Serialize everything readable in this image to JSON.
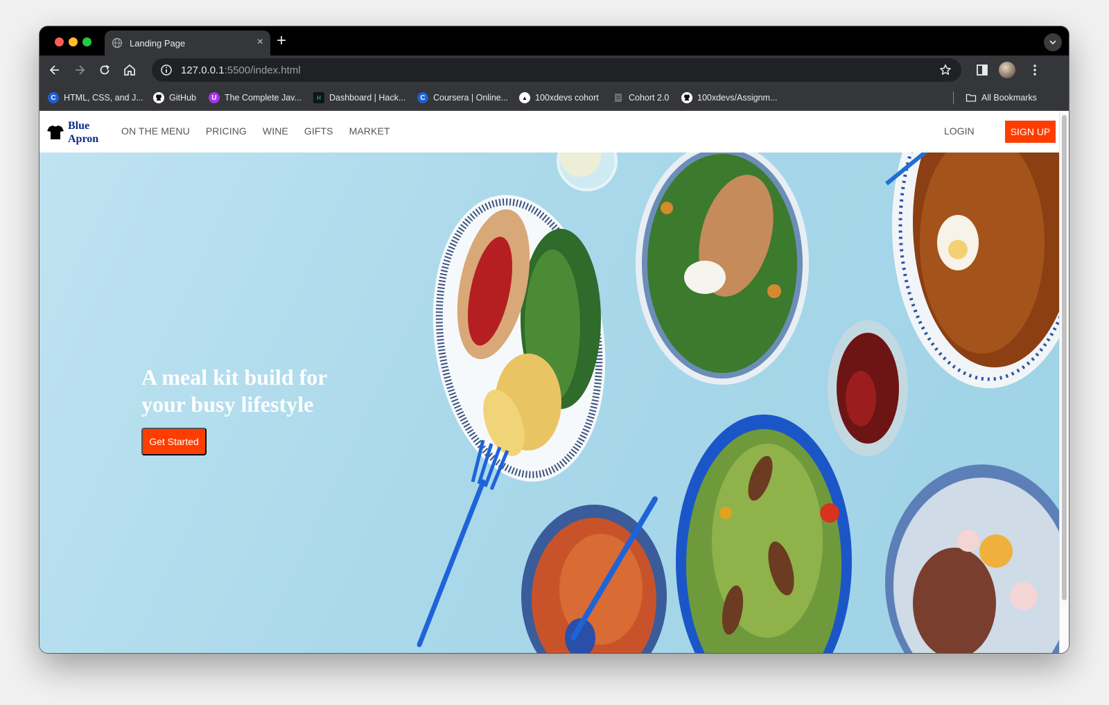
{
  "browser": {
    "tab_title": "Landing Page",
    "tab_close": "×",
    "new_tab": "+",
    "url_host": "127.0.0.1",
    "url_path": ":5500/index.html",
    "bookmarks": [
      {
        "label": "HTML, CSS, and J...",
        "icon": "coursera-icon",
        "color": "#1f5fd1",
        "glyph": "C"
      },
      {
        "label": "GitHub",
        "icon": "github-icon",
        "color": "#ffffff",
        "glyph": ""
      },
      {
        "label": "The Complete Jav...",
        "icon": "udemy-icon",
        "color": "#a435f0",
        "glyph": "U"
      },
      {
        "label": "Dashboard | Hack...",
        "icon": "hackerrank-icon",
        "color": "#1ba94c",
        "glyph": "H"
      },
      {
        "label": "Coursera | Online...",
        "icon": "coursera-icon",
        "color": "#1f5fd1",
        "glyph": "C"
      },
      {
        "label": "100xdevs cohort",
        "icon": "triangle-icon",
        "color": "#ffffff",
        "glyph": "▲"
      },
      {
        "label": "Cohort 2.0",
        "icon": "page-icon",
        "color": "#9aa0a6",
        "glyph": ""
      },
      {
        "label": "100xdevs/Assignm...",
        "icon": "github-icon",
        "color": "#ffffff",
        "glyph": ""
      }
    ],
    "all_bookmarks": "All Bookmarks"
  },
  "site": {
    "logo_line1": "Blue",
    "logo_line2": "Apron",
    "nav": [
      "ON THE MENU",
      "PRICING",
      "WINE",
      "GIFTS",
      "MARKET"
    ],
    "login": "LOGIN",
    "signup": "SIGN UP",
    "accent": "#ff3d00",
    "hero": {
      "headline_line1": "A meal kit build for",
      "headline_line2": "your busy lifestyle",
      "cta": "Get Started"
    }
  }
}
